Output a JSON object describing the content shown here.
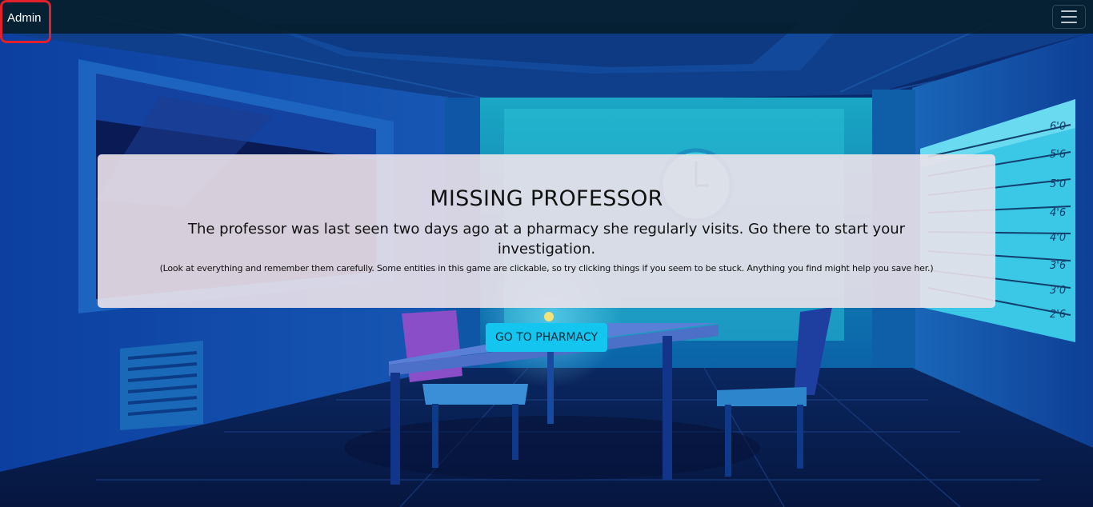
{
  "navbar": {
    "brand": "Admin",
    "menu_icon": "hamburger-menu-icon"
  },
  "intro": {
    "title": "MISSING PROFESSOR",
    "lead": "The professor was last seen two days ago at a pharmacy she regularly visits. Go there to start your investigation.",
    "note": "(Look at everything and remember them carefully. Some entities in this game are clickable, so try clicking things if you seem to be stuck. Anything you find might help you save her.)"
  },
  "action": {
    "button_label": "GO TO PHARMACY"
  },
  "scene": {
    "height_chart_marks": [
      "6'0",
      "5'6",
      "5'0",
      "4'6",
      "4'0",
      "3'6",
      "3'0",
      "2'6"
    ]
  },
  "colors": {
    "button": "#14c6ef",
    "brand_highlight": "#e0202a"
  }
}
